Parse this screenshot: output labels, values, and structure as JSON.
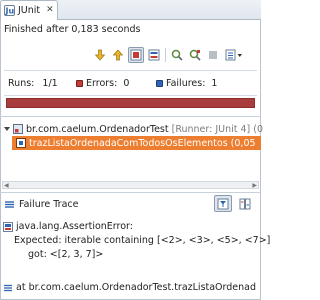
{
  "tab": {
    "label": "JUnit",
    "close": "✕",
    "icon": "junit-icon"
  },
  "status": {
    "text": "Finished after 0,183 seconds"
  },
  "toolbar": {
    "icons": [
      "next-failure-icon",
      "previous-failure-icon",
      "show-failures-only-icon",
      "scroll-lock-icon",
      "rerun-icon",
      "rerun-failed-first-icon",
      "stop-icon",
      "history-dropdown-icon"
    ]
  },
  "counters": {
    "runs_label": "Runs:",
    "runs_value": "1/1",
    "errors_label": "Errors:",
    "errors_value": "0",
    "failures_label": "Failures:",
    "failures_value": "1"
  },
  "progress": {
    "state": "failed",
    "fraction": 1.0,
    "color": "#a83b3b"
  },
  "tree": {
    "suite": {
      "name": "br.com.caelum.OrdenadorTest",
      "runner": "[Runner: JUnit 4]",
      "time": "(0"
    },
    "test": {
      "name": "trazListaOrdenadaComTodosOsElementos",
      "time": "(0,05"
    }
  },
  "failure_trace": {
    "title": "Failure Trace",
    "lines": [
      "java.lang.AssertionError:",
      "Expected: iterable containing [<2>, <3>, <5>, <7>]",
      "got: <[2, 3, 7]>",
      "at br.com.caelum.OrdenadorTest.trazListaOrdenad"
    ]
  },
  "colors": {
    "selection": "#ed7d2f",
    "failure_bar": "#a83b3b",
    "accent": "#2f63b3"
  }
}
